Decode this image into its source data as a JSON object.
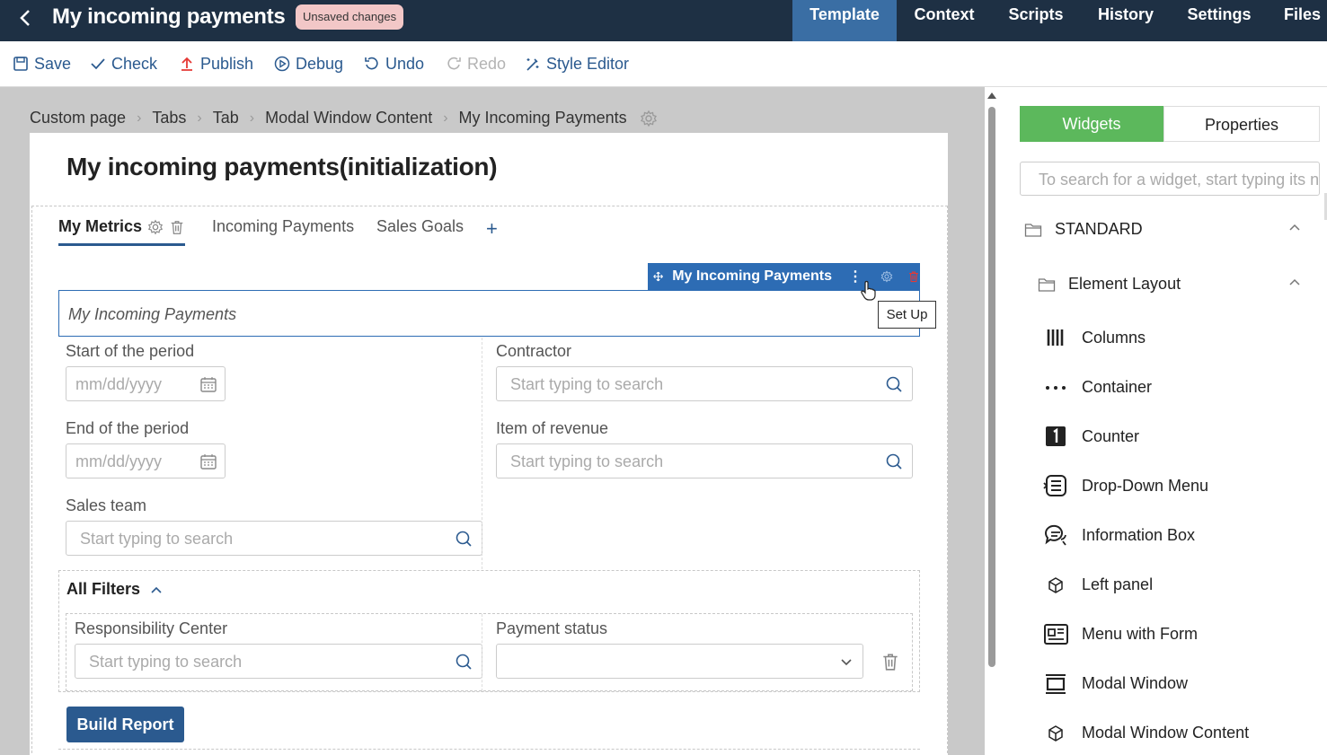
{
  "header": {
    "title": "My incoming payments",
    "badge": "Unsaved changes",
    "tabs": [
      {
        "label": "Template",
        "active": true
      },
      {
        "label": "Context"
      },
      {
        "label": "Scripts"
      },
      {
        "label": "History"
      },
      {
        "label": "Settings"
      },
      {
        "label": "Files"
      }
    ]
  },
  "toolbar": {
    "save": "Save",
    "check": "Check",
    "publish": "Publish",
    "debug": "Debug",
    "undo": "Undo",
    "redo": "Redo",
    "style_editor": "Style Editor"
  },
  "breadcrumb": [
    "Custom page",
    "Tabs",
    "Tab",
    "Modal Window Content",
    "My Incoming Payments"
  ],
  "page": {
    "title": "My incoming payments(initialization)",
    "tabs": [
      "My Metrics",
      "Incoming Payments",
      "Sales Goals"
    ],
    "widget_bar_name": "My Incoming Payments",
    "widget_title": "My Incoming Payments",
    "tooltip": "Set Up",
    "fields": {
      "start_label": "Start of the period",
      "end_label": "End of the period",
      "date_placeholder": "mm/dd/yyyy",
      "contractor_label": "Contractor",
      "revenue_label": "Item of revenue",
      "sales_team_label": "Sales team",
      "search_placeholder": "Start typing to search"
    },
    "filters": {
      "title": "All Filters",
      "responsibility_label": "Responsibility Center",
      "payment_status_label": "Payment status",
      "payment_status_value": ""
    },
    "build_button": "Build Report"
  },
  "rpanel": {
    "tab_widgets": "Widgets",
    "tab_properties": "Properties",
    "search_placeholder": "To search for a widget, start typing its name",
    "group": "STANDARD",
    "subgroup": "Element Layout",
    "items": [
      {
        "label": "Columns",
        "icon": "columns-icon"
      },
      {
        "label": "Container",
        "icon": "dots-icon"
      },
      {
        "label": "Counter",
        "icon": "counter-icon"
      },
      {
        "label": "Drop-Down Menu",
        "icon": "dropdown-menu-icon"
      },
      {
        "label": "Information Box",
        "icon": "chat-icon"
      },
      {
        "label": "Left panel",
        "icon": "cube-icon"
      },
      {
        "label": "Menu with Form",
        "icon": "menu-form-icon"
      },
      {
        "label": "Modal Window",
        "icon": "modal-window-icon"
      },
      {
        "label": "Modal Window Content",
        "icon": "cube-icon"
      }
    ]
  },
  "colors": {
    "topbar": "#1e3044",
    "active_tab": "#3a6ea4",
    "accent": "#2b5a8f",
    "widget_bar": "#2d6cb4",
    "widgets_tab": "#5cb85c",
    "danger": "#e53935"
  }
}
